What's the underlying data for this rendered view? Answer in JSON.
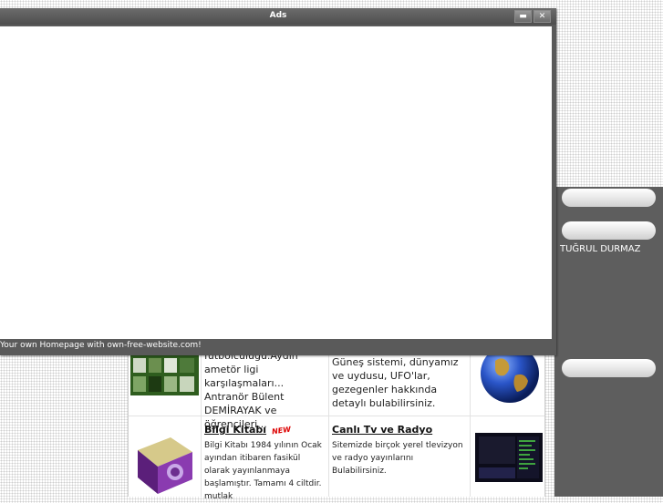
{
  "ads_window": {
    "title": "Ads",
    "footer": "Your own Homepage with own-free-website.com!"
  },
  "sidebar": {
    "name": "TUĞRUL DURMAZ"
  },
  "items": [
    {
      "text_lines": [
        "futbolculuğu.Aydın",
        "ametör ligi karşılaşmaları...",
        "Antranör Bülent",
        "DEMİRAYAK ve",
        "öğrencileri..."
      ],
      "image": "photo-collage"
    },
    {
      "text": "Güneş sistemi, dünyamız ve uydusu, UFO'lar, gezegenler hakkında detaylı  bulabilirsiniz.",
      "image": "globe"
    },
    {
      "title": "Bilgi Kitabı",
      "badge": "NEW",
      "text": "Bilgi Kitabı 1984 yılının Ocak ayından itibaren fasikül olarak yayınlanmaya başlamıştır. Tamamı 4 ciltdir. mutlak",
      "image": "book"
    },
    {
      "title": "Canlı Tv ve Radyo",
      "text": "Sitemizde birçok yerel tlevizyon ve radyo yayınlarını Bulabilirsiniz.",
      "image": "tv-screenshot"
    }
  ]
}
